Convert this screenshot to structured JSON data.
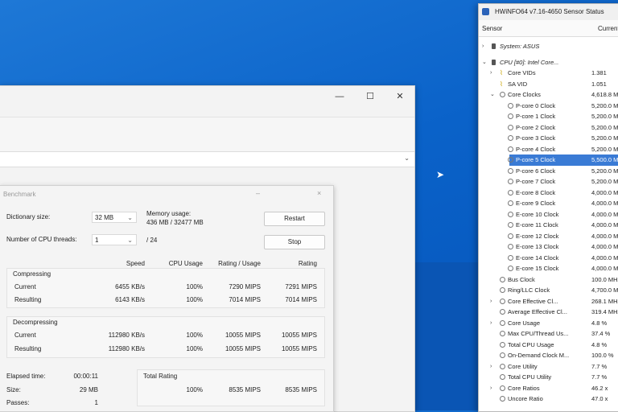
{
  "desktop": {
    "accent_color": "#0a62c9"
  },
  "benchmark": {
    "title": "Benchmark",
    "close_glyph": "×",
    "minimize_glyph": "–",
    "dictionary_size_label": "Dictionary size:",
    "dictionary_size_value": "32 MB",
    "cpu_threads_label": "Number of CPU threads:",
    "cpu_threads_value": "1",
    "cpu_threads_total": "/ 24",
    "memory_usage_label": "Memory usage:",
    "memory_usage_value": "436 MB / 32477 MB",
    "restart_label": "Restart",
    "stop_label": "Stop",
    "columns": {
      "speed": "Speed",
      "cpu_usage": "CPU Usage",
      "rating_usage": "Rating / Usage",
      "rating": "Rating"
    },
    "compressing": {
      "label": "Compressing",
      "current": {
        "label": "Current",
        "speed": "6455 KB/s",
        "cpu": "100%",
        "rating_usage": "7290 MIPS",
        "rating": "7291 MIPS"
      },
      "resulting": {
        "label": "Resulting",
        "speed": "6143 KB/s",
        "cpu": "100%",
        "rating_usage": "7014 MIPS",
        "rating": "7014 MIPS"
      }
    },
    "decompressing": {
      "label": "Decompressing",
      "current": {
        "label": "Current",
        "speed": "112980 KB/s",
        "cpu": "100%",
        "rating_usage": "10055 MIPS",
        "rating": "10055 MIPS"
      },
      "resulting": {
        "label": "Resulting",
        "speed": "112980 KB/s",
        "cpu": "100%",
        "rating_usage": "10055 MIPS",
        "rating": "10055 MIPS"
      }
    },
    "elapsed_label": "Elapsed time:",
    "elapsed_value": "00:00:11",
    "size_label": "Size:",
    "size_value": "29 MB",
    "passes_label": "Passes:",
    "passes_value": "1",
    "total_rating_label": "Total Rating",
    "total_cpu": "100%",
    "total_rating_usage": "8535 MIPS",
    "total_rating": "8535 MIPS"
  },
  "hwinfo": {
    "title": "HWiNFO64 v7.16-4650 Sensor Status",
    "col_sensor": "Sensor",
    "col_current": "Current",
    "rows": [
      {
        "name": "System: ASUS",
        "value": "",
        "indent": 0,
        "icon": "square",
        "expander": "›"
      },
      {
        "name": "CPU [#0]: Intel Core...",
        "value": "",
        "indent": 0,
        "icon": "square",
        "expander": "⌄"
      },
      {
        "name": "Core VIDs",
        "value": "1.381",
        "indent": 1,
        "icon": "volt",
        "expander": "›"
      },
      {
        "name": "SA VID",
        "value": "1.051",
        "indent": 1,
        "icon": "volt",
        "expander": ""
      },
      {
        "name": "Core Clocks",
        "value": "4,618.8 MHz",
        "indent": 1,
        "icon": "clock",
        "expander": "⌄"
      },
      {
        "name": "P-core 0 Clock",
        "value": "5,200.0 MHz",
        "indent": 2,
        "icon": "clock",
        "expander": ""
      },
      {
        "name": "P-core 1 Clock",
        "value": "5,200.0 MHz",
        "indent": 2,
        "icon": "clock",
        "expander": ""
      },
      {
        "name": "P-core 2 Clock",
        "value": "5,200.0 MHz",
        "indent": 2,
        "icon": "clock",
        "expander": ""
      },
      {
        "name": "P-core 3 Clock",
        "value": "5,200.0 MHz",
        "indent": 2,
        "icon": "clock",
        "expander": ""
      },
      {
        "name": "P-core 4 Clock",
        "value": "5,200.0 MHz",
        "indent": 2,
        "icon": "clock",
        "expander": ""
      },
      {
        "name": "P-core 5 Clock",
        "value": "5,500.0 MHz",
        "indent": 2,
        "icon": "clock",
        "expander": "",
        "selected": true
      },
      {
        "name": "P-core 6 Clock",
        "value": "5,200.0 MHz",
        "indent": 2,
        "icon": "clock",
        "expander": ""
      },
      {
        "name": "P-core 7 Clock",
        "value": "5,200.0 MHz",
        "indent": 2,
        "icon": "clock",
        "expander": ""
      },
      {
        "name": "E-core 8 Clock",
        "value": "4,000.0 MHz",
        "indent": 2,
        "icon": "clock",
        "expander": ""
      },
      {
        "name": "E-core 9 Clock",
        "value": "4,000.0 MHz",
        "indent": 2,
        "icon": "clock",
        "expander": ""
      },
      {
        "name": "E-core 10 Clock",
        "value": "4,000.0 MHz",
        "indent": 2,
        "icon": "clock",
        "expander": ""
      },
      {
        "name": "E-core 11 Clock",
        "value": "4,000.0 MHz",
        "indent": 2,
        "icon": "clock",
        "expander": ""
      },
      {
        "name": "E-core 12 Clock",
        "value": "4,000.0 MHz",
        "indent": 2,
        "icon": "clock",
        "expander": ""
      },
      {
        "name": "E-core 13 Clock",
        "value": "4,000.0 MHz",
        "indent": 2,
        "icon": "clock",
        "expander": ""
      },
      {
        "name": "E-core 14 Clock",
        "value": "4,000.0 MHz",
        "indent": 2,
        "icon": "clock",
        "expander": ""
      },
      {
        "name": "E-core 15 Clock",
        "value": "4,000.0 MHz",
        "indent": 2,
        "icon": "clock",
        "expander": ""
      },
      {
        "name": "Bus Clock",
        "value": "100.0 MHz",
        "indent": 1,
        "icon": "clock",
        "expander": ""
      },
      {
        "name": "Ring/LLC Clock",
        "value": "4,700.0 MHz",
        "indent": 1,
        "icon": "clock",
        "expander": ""
      },
      {
        "name": "Core Effective Cl...",
        "value": "268.1 MHz",
        "indent": 1,
        "icon": "clock",
        "expander": "›"
      },
      {
        "name": "Average Effective Cl...",
        "value": "319.4 MHz",
        "indent": 1,
        "icon": "clock",
        "expander": ""
      },
      {
        "name": "Core Usage",
        "value": "4.8 %",
        "indent": 1,
        "icon": "clock",
        "expander": "›"
      },
      {
        "name": "Max CPU/Thread Us...",
        "value": "37.4 %",
        "indent": 1,
        "icon": "clock",
        "expander": ""
      },
      {
        "name": "Total CPU Usage",
        "value": "4.8 %",
        "indent": 1,
        "icon": "clock",
        "expander": ""
      },
      {
        "name": "On-Demand Clock M...",
        "value": "100.0 %",
        "indent": 1,
        "icon": "clock",
        "expander": ""
      },
      {
        "name": "Core Utility",
        "value": "7.7 %",
        "indent": 1,
        "icon": "clock",
        "expander": "›"
      },
      {
        "name": "Total CPU Utility",
        "value": "7.7 %",
        "indent": 1,
        "icon": "clock",
        "expander": ""
      },
      {
        "name": "Core Ratios",
        "value": "46.2 x",
        "indent": 1,
        "icon": "clock",
        "expander": "›"
      },
      {
        "name": "Uncore Ratio",
        "value": "47.0 x",
        "indent": 1,
        "icon": "clock",
        "expander": ""
      }
    ]
  }
}
